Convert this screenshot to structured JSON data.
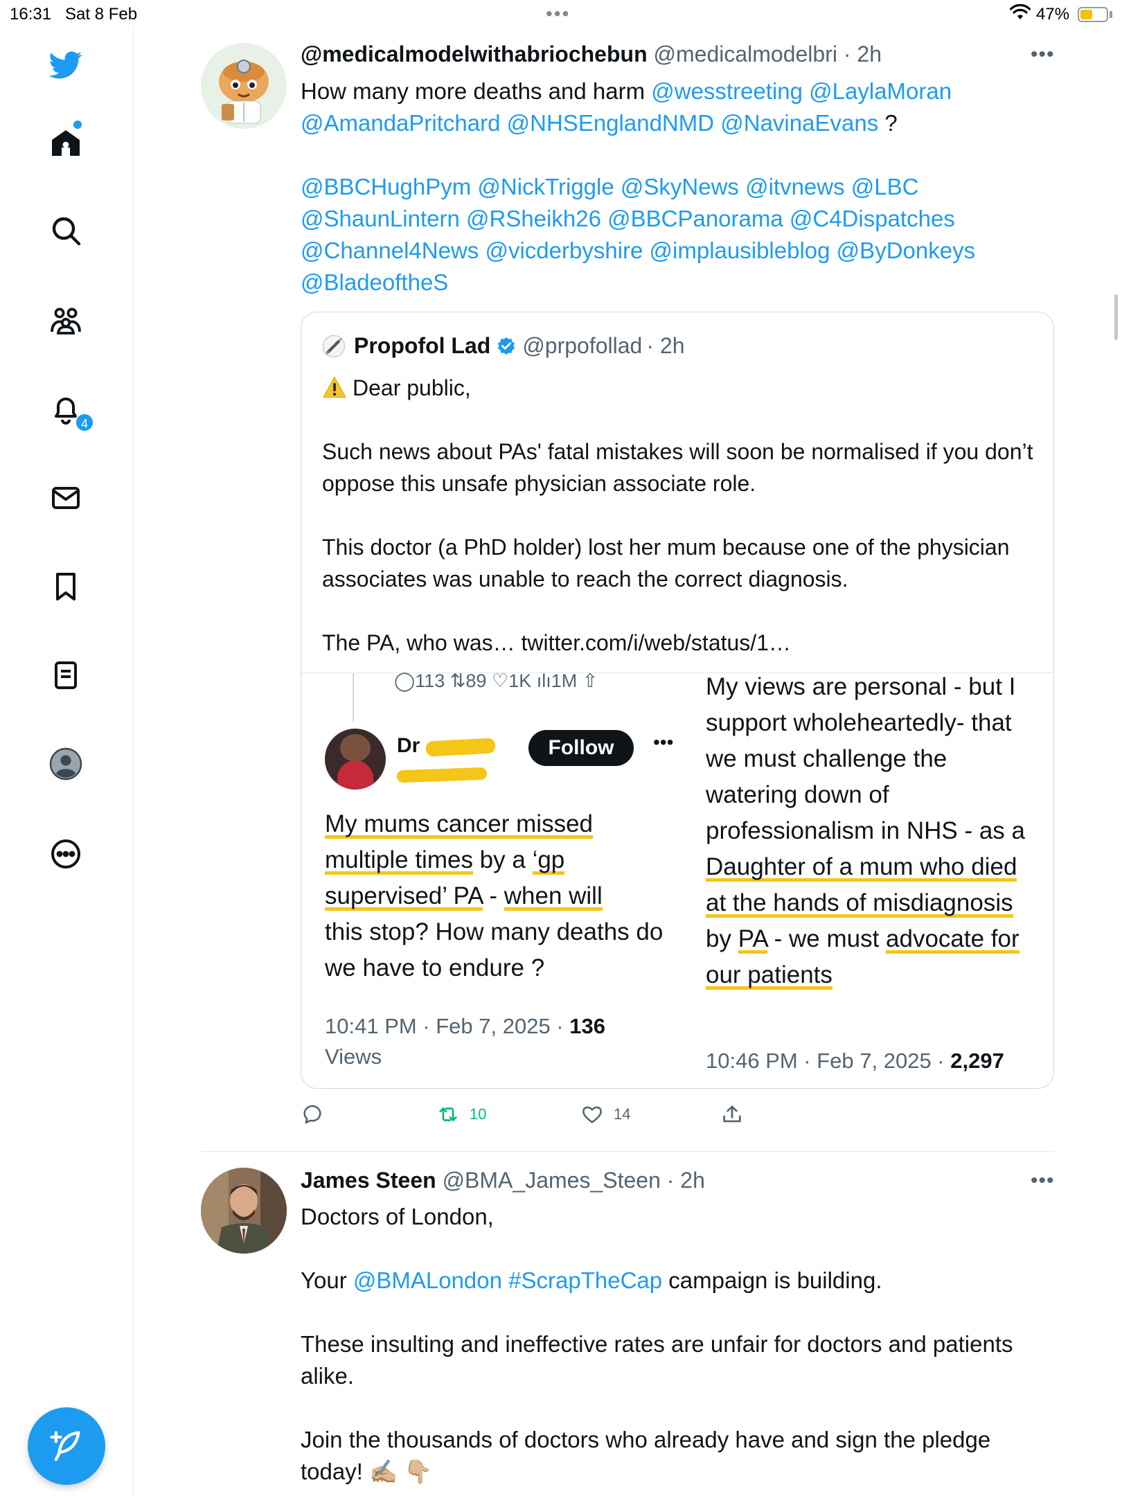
{
  "status_bar": {
    "time": "16:31",
    "date": "Sat 8 Feb",
    "battery": "47%",
    "battery_level": 0.47
  },
  "sidebar": {
    "items": [
      {
        "name": "twitter-logo"
      },
      {
        "name": "home"
      },
      {
        "name": "search"
      },
      {
        "name": "communities"
      },
      {
        "name": "notifications",
        "badge": "4"
      },
      {
        "name": "messages"
      },
      {
        "name": "bookmarks"
      },
      {
        "name": "lists"
      },
      {
        "name": "profile"
      },
      {
        "name": "more"
      }
    ],
    "notification_count": "4"
  },
  "tweet1": {
    "name": "@medicalmodelwithabriochebun",
    "handle": "@medicalmodelbri",
    "time": "· 2h",
    "text_line1_plain": "How many more deaths and harm ",
    "mentions_row1": [
      "@wesstreeting",
      "@LaylaMoran"
    ],
    "mentions_row2": [
      "@AmandaPritchard",
      "@NHSEnglandNMD",
      "@NavinaEvans"
    ],
    "question_mark": " ?",
    "mentions_block": [
      "@BBCHughPym @NickTriggle @SkyNews @itvnews @LBC",
      "@ShaunLintern @RSheikh26 @BBCPanorama @C4Dispatches",
      "@Channel4News @vicderbyshire @implausibleblog @ByDonkeys",
      "@BladeoftheS"
    ],
    "quote": {
      "name": "Propofol Lad",
      "handle": "@prpofollad",
      "time": "· 2h",
      "warning_emoji": "⚠️",
      "para1": "Dear public,",
      "para2": "Such news about PAs' fatal mistakes will soon be normalised if you don’t oppose this unsafe physician associate role.",
      "para3": "This doctor (a PhD holder) lost her mum because one of the physician associates was unable to reach the correct diagnosis.",
      "para4": "The PA, who was… twitter.com/i/web/status/1…",
      "image": {
        "left_stats": [
          "113",
          "89",
          "1K",
          "1M"
        ],
        "left_name": "Dr",
        "follow_label": "Follow",
        "left_text_parts": [
          "My mums cancer missed",
          "multiple times",
          " by a ",
          "‘gp",
          "supervised’ PA",
          " - ",
          "when will",
          "this stop? How many deaths do we have to endure ?"
        ],
        "left_time": "10:41 PM · Feb 7, 2025 · ",
        "left_views_count": "136",
        "left_views_label": "Views",
        "right_text_intro": "My views are personal - but I support wholeheartedly- that we must challenge the watering down of professionalism in NHS - as a ",
        "right_hl1": "Daughter of a mum who died at the hands of misdiagnosis",
        "right_mid1": " by ",
        "right_hl2": "PA",
        "right_mid2": " - we must ",
        "right_hl3": "advocate for our patients",
        "right_time": "10:46 PM · Feb 7, 2025 · ",
        "right_views_count": "2,297"
      }
    },
    "actions": {
      "reply": "",
      "retweets": "10",
      "likes": "14"
    }
  },
  "tweet2": {
    "name": "James Steen",
    "handle": "@BMA_James_Steen",
    "time": "· 2h",
    "line1": "Doctors of London,",
    "line2_pre": "Your ",
    "line2_mention": "@BMALondon",
    "line2_hashtag": "#ScrapTheCap",
    "line2_post": " campaign is building.",
    "line3": "These insulting and ineffective rates are unfair for doctors and patients alike.",
    "line4": "Join the thousands of doctors who already have and sign the pledge today! ✍🏼 👇🏼"
  },
  "colors": {
    "accent": "#1d9bf0",
    "retweet_green": "#00ba7c",
    "highlight_yellow": "#f5c518"
  }
}
